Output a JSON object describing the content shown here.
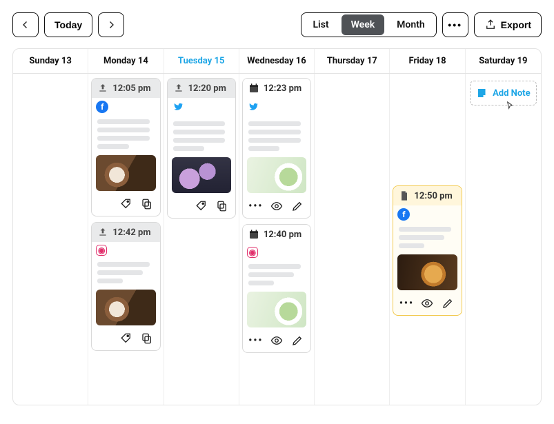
{
  "toolbar": {
    "prev_aria": "Previous",
    "next_aria": "Next",
    "today_label": "Today",
    "views": {
      "list": "List",
      "week": "Week",
      "month": "Month",
      "active": "Week"
    },
    "more_aria": "More",
    "export_label": "Export"
  },
  "dayHeaders": [
    {
      "label": "Sunday 13",
      "active": false
    },
    {
      "label": "Monday 14",
      "active": false
    },
    {
      "label": "Tuesday 15",
      "active": true
    },
    {
      "label": "Wednesday 16",
      "active": false
    },
    {
      "label": "Thursday 17",
      "active": false
    },
    {
      "label": "Friday 18",
      "active": false
    },
    {
      "label": "Saturday 19",
      "active": false
    }
  ],
  "posts": {
    "mon1": {
      "time": "12:05 pm",
      "status": "scheduled",
      "network": "facebook",
      "image": "coffee"
    },
    "mon2": {
      "time": "12:42 pm",
      "status": "scheduled",
      "network": "instagram",
      "image": "coffee"
    },
    "tue1": {
      "time": "12:20 pm",
      "status": "scheduled",
      "network": "twitter",
      "image": "lilac"
    },
    "wed1": {
      "time": "12:23 pm",
      "status": "planned",
      "network": "twitter",
      "image": "matcha"
    },
    "wed2": {
      "time": "12:40 pm",
      "status": "planned",
      "network": "instagram",
      "image": "matcha"
    },
    "fri1": {
      "time": "12:50 pm",
      "status": "draft",
      "network": "facebook",
      "image": "whiskey"
    }
  },
  "addNote": {
    "label": "Add Note"
  },
  "icons": {
    "tag_label": "tag",
    "copy_label": "copy",
    "more_label": "more",
    "preview_label": "preview",
    "edit_label": "edit"
  }
}
